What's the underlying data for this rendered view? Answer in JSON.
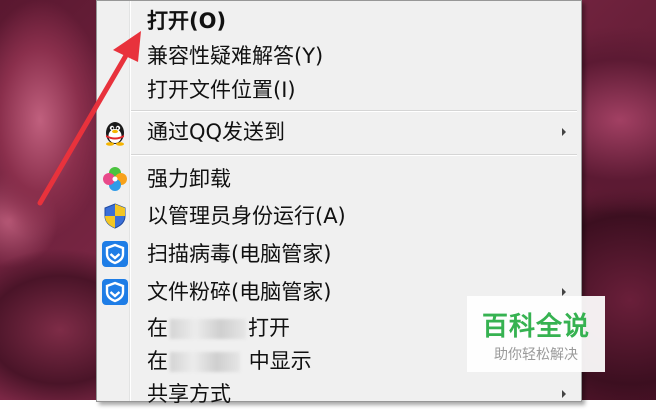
{
  "context_menu": {
    "items": [
      {
        "label": "打开(O)",
        "bold": true,
        "submenu": false,
        "icon": ""
      },
      {
        "label": "兼容性疑难解答(Y)",
        "bold": false,
        "submenu": false,
        "icon": ""
      },
      {
        "label": "打开文件位置(I)",
        "bold": false,
        "submenu": false,
        "icon": ""
      },
      {
        "label": "通过QQ发送到",
        "bold": false,
        "submenu": true,
        "icon": "qq-penguin-icon"
      },
      {
        "label": "强力卸载",
        "bold": false,
        "submenu": false,
        "icon": "clover-icon"
      },
      {
        "label": "以管理员身份运行(A)",
        "bold": false,
        "submenu": false,
        "icon": "uac-shield-icon"
      },
      {
        "label": "扫描病毒(电脑管家)",
        "bold": false,
        "submenu": false,
        "icon": "tencent-guard-icon"
      },
      {
        "label": "文件粉碎(电脑管家)",
        "bold": false,
        "submenu": true,
        "icon": "tencent-guard-icon"
      },
      {
        "label_prefix": "在",
        "label_suffix": "打开",
        "bold": false,
        "submenu": false,
        "icon": ""
      },
      {
        "label_prefix": "在",
        "label_suffix": "中显示",
        "bold": false,
        "submenu": false,
        "icon": ""
      },
      {
        "label": "共享方式",
        "bold": false,
        "submenu": true,
        "icon": ""
      }
    ]
  },
  "watermark": {
    "title": "百科全说",
    "subtitle": "助你轻松解决",
    "color": "#36b251"
  },
  "annotation": {
    "arrow_color": "#e8323c"
  }
}
